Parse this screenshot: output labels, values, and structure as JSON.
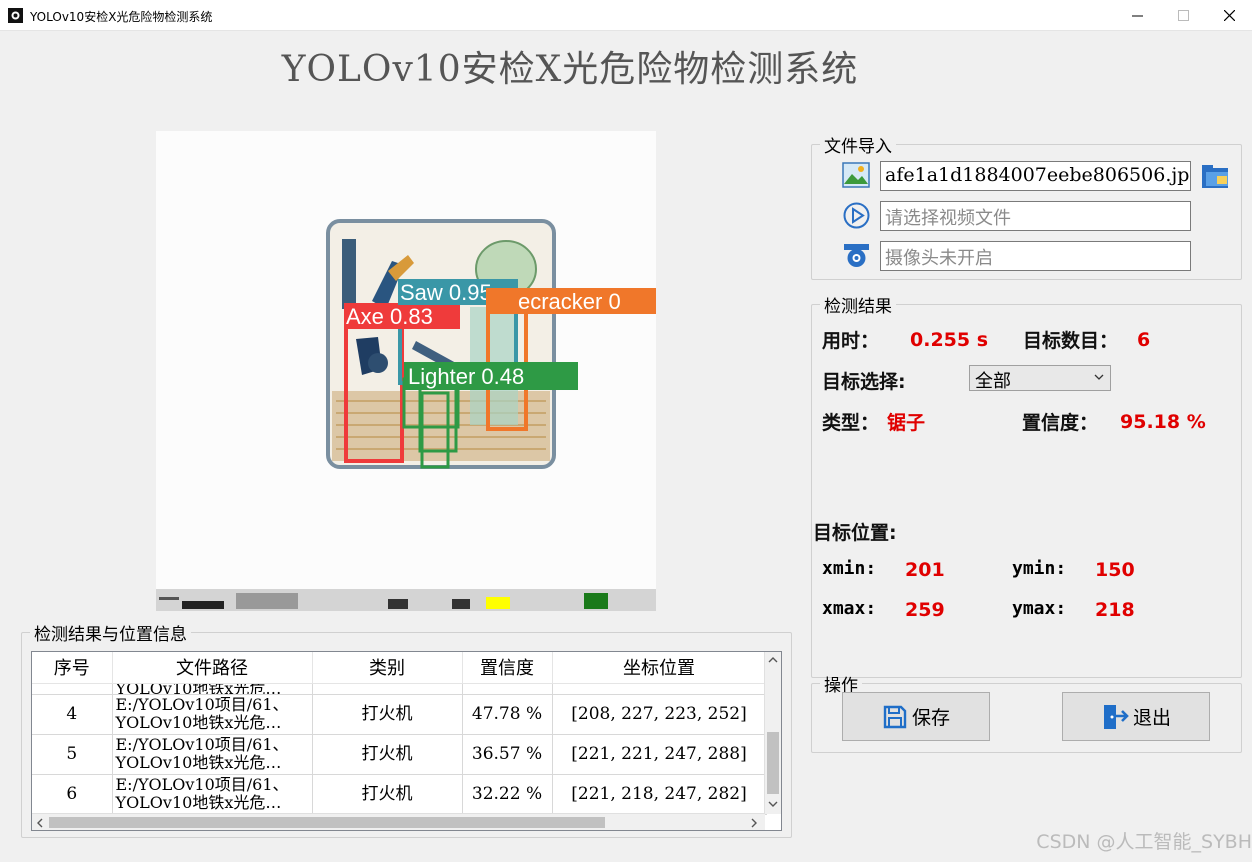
{
  "window": {
    "title": "YOLOv10安检X光危险物检测系统"
  },
  "app_title": "YOLOv10安检X光危险物检测系统",
  "file_import": {
    "legend": "文件导入",
    "image_file": "afe1a1d1884007eebe806506.jpg",
    "video_placeholder": "请选择视频文件",
    "camera_placeholder": "摄像头未开启"
  },
  "results": {
    "legend": "检测结果",
    "time_label": "用时：",
    "time_value": "0.255 s",
    "count_label": "目标数目：",
    "count_value": "6",
    "select_label": "目标选择:",
    "select_value": "全部",
    "type_label": "类型：",
    "type_value": "锯子",
    "conf_label": "置信度：",
    "conf_value": "95.18 %",
    "position_label": "目标位置:",
    "xmin_label": "xmin:",
    "xmin_value": "201",
    "ymin_label": "ymin:",
    "ymin_value": "150",
    "xmax_label": "xmax:",
    "xmax_value": "259",
    "ymax_label": "ymax:",
    "ymax_value": "218"
  },
  "operations": {
    "legend": "操作",
    "save_label": "保存",
    "exit_label": "退出"
  },
  "table_section": {
    "legend": "检测结果与位置信息",
    "columns": [
      "序号",
      "文件路径",
      "类别",
      "置信度",
      "坐标位置"
    ],
    "rows": [
      {
        "id": "4",
        "path1": "E:/YOLOv10项目/61、",
        "path2": "YOLOv10地铁x光危…",
        "cls": "打火机",
        "conf": "47.78 %",
        "coords": "[208, 227, 223, 252]"
      },
      {
        "id": "5",
        "path1": "E:/YOLOv10项目/61、",
        "path2": "YOLOv10地铁x光危…",
        "cls": "打火机",
        "conf": "36.57 %",
        "coords": "[221, 221, 247, 288]"
      },
      {
        "id": "6",
        "path1": "E:/YOLOv10项目/61、",
        "path2": "YOLOv10地铁x光危…",
        "cls": "打火机",
        "conf": "32.22 %",
        "coords": "[221, 218, 247, 282]"
      }
    ],
    "partial_row_path": "YOLOv10地铁x光危…"
  },
  "detections": [
    {
      "label": "Saw 0.95",
      "color": "#3a97a7"
    },
    {
      "label": "Axe 0.83",
      "color": "#ef3b3b"
    },
    {
      "label": "ecracker 0",
      "color": "#f0772a"
    },
    {
      "label": "Lighter 0.48",
      "color": "#2e9a45"
    }
  ],
  "watermark": "CSDN @人工智能_SYBH"
}
